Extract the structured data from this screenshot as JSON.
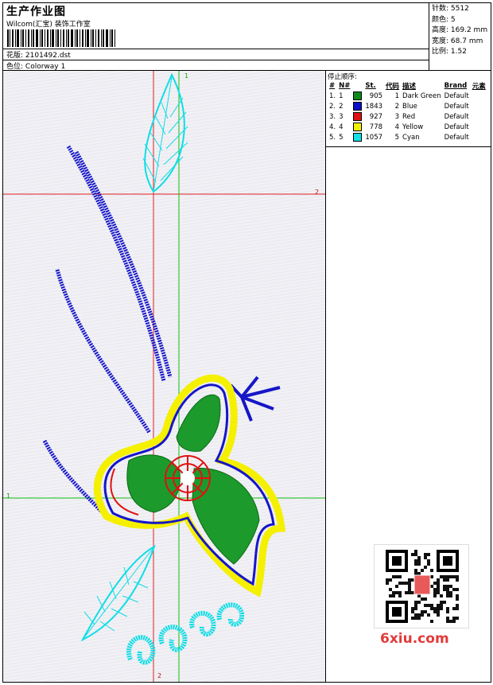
{
  "header": {
    "title": "生产作业图",
    "company": "Wilcom(汇宝) 装饰工作室",
    "design_label": "花版:",
    "design_file": "2101492.dst",
    "colorway_label": "色位:",
    "colorway": "Colorway 1"
  },
  "stats": {
    "stitches_label": "针数:",
    "stitches": "5512",
    "colors_label": "颜色:",
    "colors": "5",
    "height_label": "高度:",
    "height": "169.2 mm",
    "width_label": "宽度:",
    "width": "68.7 mm",
    "scale_label": "比例:",
    "scale": "1.52"
  },
  "stop_sequence": {
    "caption": "停止顺序:",
    "columns": [
      "#",
      "N#",
      "St.",
      "代码",
      "描述",
      "Brand",
      "元素"
    ],
    "rows": [
      {
        "idx": "1.",
        "n": "1",
        "st": "905",
        "code": "1",
        "desc": "Dark Green",
        "brand": "Default",
        "color": "#0b8a1c"
      },
      {
        "idx": "2.",
        "n": "2",
        "st": "1843",
        "code": "2",
        "desc": "Blue",
        "brand": "Default",
        "color": "#0a10c8"
      },
      {
        "idx": "3.",
        "n": "3",
        "st": "927",
        "code": "3",
        "desc": "Red",
        "brand": "Default",
        "color": "#e01010"
      },
      {
        "idx": "4.",
        "n": "4",
        "st": "778",
        "code": "4",
        "desc": "Yellow",
        "brand": "Default",
        "color": "#f2f200"
      },
      {
        "idx": "5.",
        "n": "5",
        "st": "1057",
        "code": "5",
        "desc": "Cyan",
        "brand": "Default",
        "color": "#10e0e8"
      }
    ]
  },
  "axis_labels": {
    "green_top": "1",
    "green_left": "1",
    "red_right": "2",
    "red_bottom": "2"
  },
  "watermark": "6xiu.com"
}
